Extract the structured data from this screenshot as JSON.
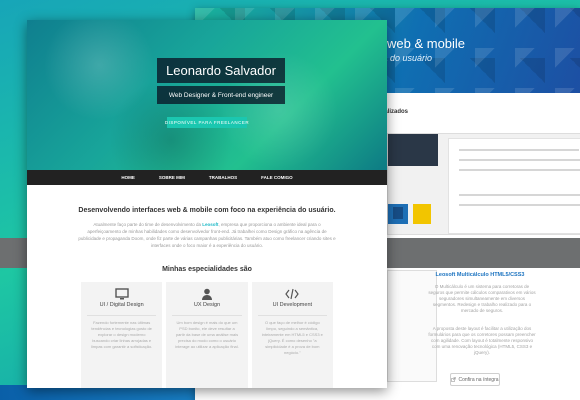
{
  "front": {
    "hero": {
      "name": "Leonardo Salvador",
      "role": "Web Designer & Front-end engineer",
      "cta": "DISPONÍVEL PARA FREELANCER"
    },
    "nav": [
      "HOME",
      "SOBRE MIM",
      "TRABALHOS",
      "FALE COMIGO"
    ],
    "intro": {
      "title": "Desenvolvendo interfaces web & mobile com foco na experiência do usuário.",
      "text_before": "Atualmente faço parte do time de desenvolvimento da ",
      "highlight": "Leosoft",
      "text_after": ", empresa que proporciona o ambiente ideal para o aperfeiçoamento de minhas habilidades como desenvolvedor front-end. Já trabalhei como Design gráfico na agência de publicidade e propaganda Doom, onde fiz parte de várias campanhas publicitárias. Também atuo como freelancer criando sites e interfaces onde o foco maior é a experiência do usuário."
    },
    "specialties_title": "Minhas especialidades são",
    "specialties": [
      {
        "icon": "monitor-icon",
        "title": "UI / Digital Design",
        "text": "Fazendo fortemente nas últimas tendências e tecnologias gosto de explorar o design moderno buscando criar linhas arrojadas e limpas com garantir a sofisticação."
      },
      {
        "icon": "user-icon",
        "title": "UX Design",
        "text": "Um bom design é mais do que um PSD bonito, ele deve resultar a partir da base de uma análise mais precisa do modo como o usuário interage ao utilizar a aplicação final."
      },
      {
        "icon": "code-icon",
        "title": "UI Development",
        "text": "O que faço de melhor é código limpo, seguindo a semântica, inteiramente em HTML5 e CSS3 e jQuery. É como desenho \"a simplicidade é a prova de bom negócio.\""
      }
    ]
  },
  "back": {
    "hero_title": "web & mobile",
    "hero_sub": "ncia do usuário",
    "projects_title": "ealizados",
    "product_title": "Leosoft Multicálculo HTML5/CSS3",
    "p1": "O Multicálculo é um sistema para corretoras de seguros que permite cálculos comparativos em vários seguradores simultaneamente em diversos segmentos. Redesign e trabalho realizado para o mercado de seguros.",
    "p2": "A proposta deste layout é facilitar a utilização dos formulários para que os corretores possam preencher com agilidade. Com layout é totalmente responsivo com uma renovação tecnológica (HTML5, CSS3 e jQuery).",
    "button": "Confira na íntegra"
  }
}
